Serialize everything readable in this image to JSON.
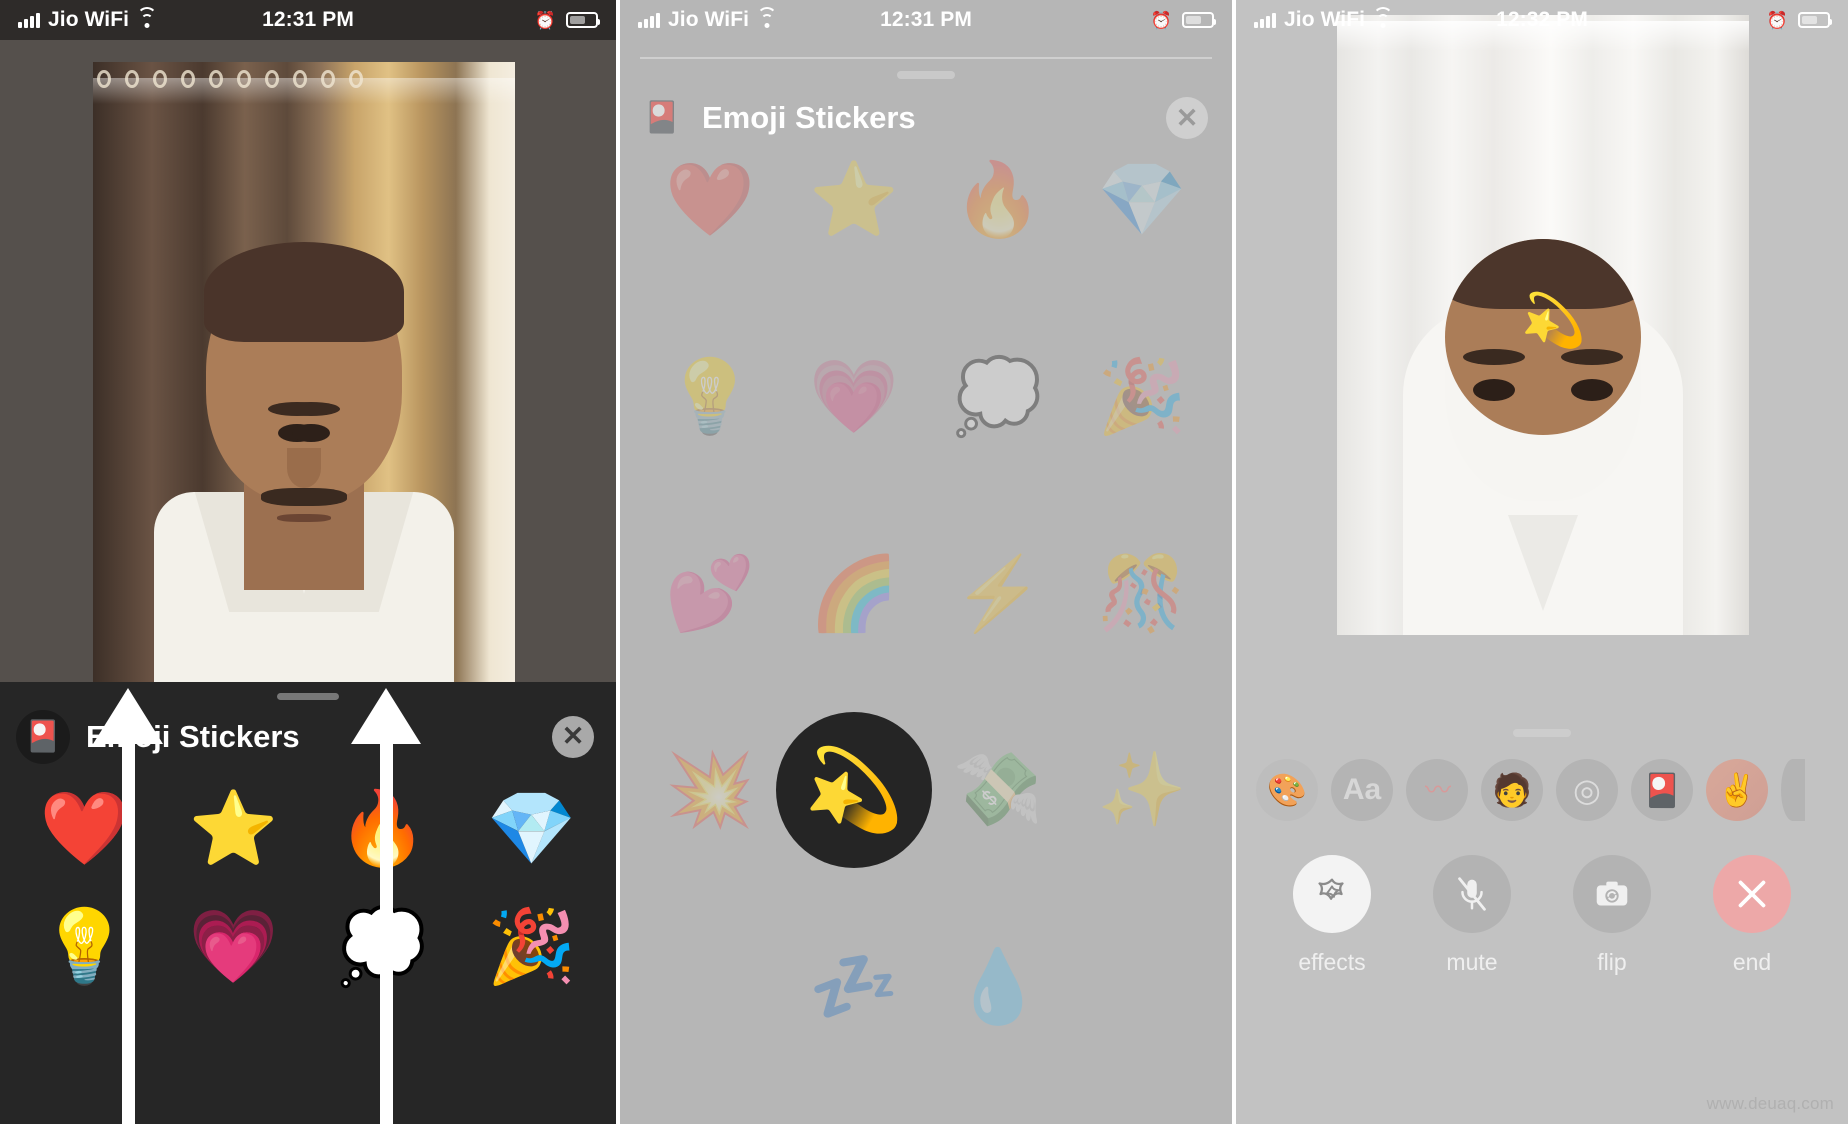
{
  "panels": [
    {
      "id": "call-with-sticker-sheet",
      "status_bar": {
        "carrier": "Jio WiFi",
        "time": "12:31 PM",
        "wifi_icon": "wifi-icon",
        "signal_icon": "signal-bars-icon",
        "alarm_icon": "alarm-clock-icon",
        "battery_icon": "battery-icon"
      },
      "sheet": {
        "pack_icon": "emoji-stickers-pack-icon",
        "pack_icon_glyph": "🎴",
        "title": "Emoji Stickers",
        "close_icon": "close-icon",
        "close_glyph": "✕",
        "grabber": "drag-handle"
      },
      "stickers": [
        {
          "name": "red-heart",
          "glyph": "❤️"
        },
        {
          "name": "star",
          "glyph": "⭐"
        },
        {
          "name": "fire",
          "glyph": "🔥"
        },
        {
          "name": "gem-stone",
          "glyph": "💎"
        },
        {
          "name": "light-bulb",
          "glyph": "💡"
        },
        {
          "name": "growing-heart",
          "glyph": "💗"
        },
        {
          "name": "thought-balloon",
          "glyph": "💭"
        },
        {
          "name": "party-popper",
          "glyph": "🎉"
        }
      ],
      "annotations": [
        {
          "name": "arrow-up-left",
          "type": "arrow-up"
        },
        {
          "name": "arrow-up-right",
          "type": "arrow-up"
        }
      ]
    },
    {
      "id": "sticker-picker-expanded",
      "status_bar": {
        "carrier": "Jio WiFi",
        "time": "12:31 PM",
        "wifi_icon": "wifi-icon",
        "signal_icon": "signal-bars-icon",
        "alarm_icon": "alarm-clock-icon",
        "battery_icon": "battery-icon"
      },
      "sheet": {
        "pack_icon": "emoji-stickers-pack-icon",
        "pack_icon_glyph": "🎴",
        "title": "Emoji Stickers",
        "close_icon": "close-icon",
        "close_glyph": "✕",
        "grabber": "drag-handle"
      },
      "stickers": [
        {
          "name": "red-heart",
          "glyph": "❤️",
          "selected": false
        },
        {
          "name": "star",
          "glyph": "⭐",
          "selected": false
        },
        {
          "name": "fire",
          "glyph": "🔥",
          "selected": false
        },
        {
          "name": "gem-stone",
          "glyph": "💎",
          "selected": false
        },
        {
          "name": "light-bulb",
          "glyph": "💡",
          "selected": false
        },
        {
          "name": "growing-heart",
          "glyph": "💗",
          "selected": false
        },
        {
          "name": "thought-balloon",
          "glyph": "💭",
          "selected": false
        },
        {
          "name": "party-popper",
          "glyph": "🎉",
          "selected": false
        },
        {
          "name": "two-hearts",
          "glyph": "💕",
          "selected": false
        },
        {
          "name": "rainbow",
          "glyph": "🌈",
          "selected": false
        },
        {
          "name": "high-voltage",
          "glyph": "⚡",
          "selected": false
        },
        {
          "name": "confetti-ball",
          "glyph": "🎊",
          "selected": false
        },
        {
          "name": "collision",
          "glyph": "💥",
          "selected": false
        },
        {
          "name": "dizzy",
          "glyph": "💫",
          "selected": true
        },
        {
          "name": "money-with-wings",
          "glyph": "💸",
          "selected": false
        },
        {
          "name": "sparkles",
          "glyph": "✨",
          "selected": false
        },
        {
          "name": "empty-slot",
          "glyph": "",
          "selected": false
        },
        {
          "name": "zzz",
          "glyph": "💤",
          "selected": false
        },
        {
          "name": "droplet",
          "glyph": "💧",
          "selected": false
        },
        {
          "name": "empty-slot-2",
          "glyph": "",
          "selected": false
        }
      ]
    },
    {
      "id": "facetime-effect-applied",
      "status_bar": {
        "carrier": "Jio WiFi",
        "time": "12:32 PM",
        "wifi_icon": "wifi-icon",
        "signal_icon": "signal-bars-icon",
        "alarm_icon": "alarm-clock-icon",
        "battery_icon": "battery-icon"
      },
      "applied_sticker": {
        "name": "dizzy-sticker-on-face",
        "glyph": "💫"
      },
      "effects_tray": [
        {
          "name": "filters-icon",
          "glyph": "🎨"
        },
        {
          "name": "text-label-icon",
          "glyph": "Aa"
        },
        {
          "name": "shapes-squiggle-icon",
          "glyph": "〰"
        },
        {
          "name": "memoji-icon",
          "glyph": "🧑"
        },
        {
          "name": "animoji-target-icon",
          "glyph": "◎"
        },
        {
          "name": "emoji-stickers-icon",
          "glyph": "🎴"
        },
        {
          "name": "memoji-stickers-icon",
          "glyph": "✌"
        },
        {
          "name": "more-effects-cut-off",
          "glyph": ""
        }
      ],
      "call_controls": [
        {
          "name": "effects-button",
          "label": "effects",
          "icon": "star-effects-icon",
          "state": "active"
        },
        {
          "name": "mute-button",
          "label": "mute",
          "icon": "microphone-muted-icon",
          "state": "default"
        },
        {
          "name": "flip-button",
          "label": "flip",
          "icon": "camera-flip-icon",
          "state": "default"
        },
        {
          "name": "end-button",
          "label": "end",
          "icon": "close-icon",
          "state": "danger"
        }
      ],
      "watermark": "www.deuaq.com"
    }
  ],
  "colors": {
    "sheet_background": "#262626",
    "dim_overlay": "#b6b6b6",
    "end_button": "#eda8a8",
    "accent_white": "#ffffff",
    "selected_circle": "#252525"
  }
}
